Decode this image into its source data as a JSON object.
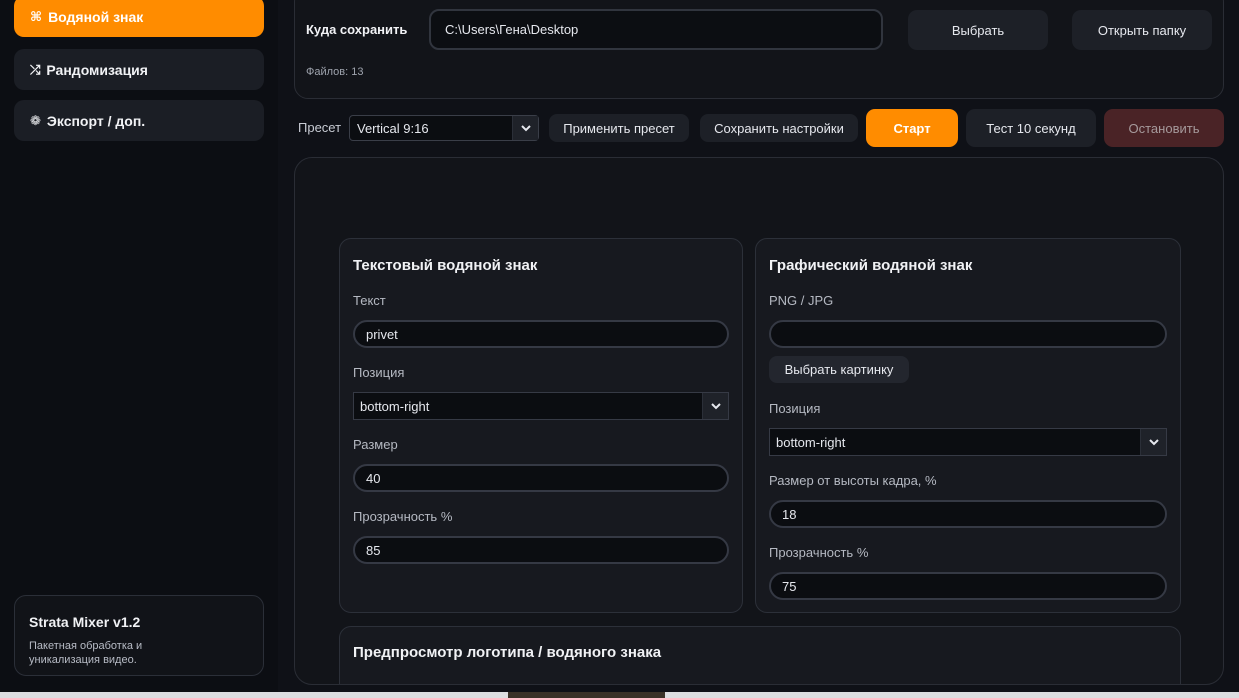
{
  "sidebar": {
    "items": [
      {
        "icon": "⌘",
        "icon_name": "command-icon",
        "label": "Водяной знак",
        "active": true
      },
      {
        "icon": "⤮",
        "icon_name": "shuffle-icon",
        "label": "Рандомизация",
        "active": false
      },
      {
        "icon": "❁",
        "icon_name": "gear-icon",
        "label": "Экспорт / доп.",
        "active": false
      }
    ],
    "about": {
      "title": "Strata Mixer v1.2",
      "description": "Пакетная обработка и уникализация видео."
    }
  },
  "output": {
    "label": "Куда сохранить",
    "path": "C:\\Users\\Гена\\Desktop",
    "choose_label": "Выбрать",
    "open_folder_label": "Открыть папку",
    "files_count": "Файлов: 13"
  },
  "toolbar": {
    "preset_label": "Пресет",
    "preset_value": "Vertical 9:16",
    "apply_label": "Применить пресет",
    "save_settings_label": "Сохранить настройки",
    "start_label": "Старт",
    "test_label": "Тест 10 секунд",
    "stop_label": "Остановить"
  },
  "text_watermark": {
    "title": "Текстовый водяной знак",
    "text_label": "Текст",
    "text_value": "privet",
    "position_label": "Позиция",
    "position_value": "bottom-right",
    "size_label": "Размер",
    "size_value": "40",
    "opacity_label": "Прозрачность %",
    "opacity_value": "85"
  },
  "image_watermark": {
    "title": "Графический водяной знак",
    "file_label": "PNG / JPG",
    "file_value": "",
    "pick_label": "Выбрать картинку",
    "position_label": "Позиция",
    "position_value": "bottom-right",
    "size_label": "Размер от высоты кадра, %",
    "size_value": "18",
    "opacity_label": "Прозрачность %",
    "opacity_value": "75"
  },
  "preview": {
    "title": "Предпросмотр логотипа / водяного знака"
  },
  "colors": {
    "accent": "#ff8c00",
    "background": "#0f1117",
    "card": "#17191f",
    "stop_button": "#4a2326"
  }
}
